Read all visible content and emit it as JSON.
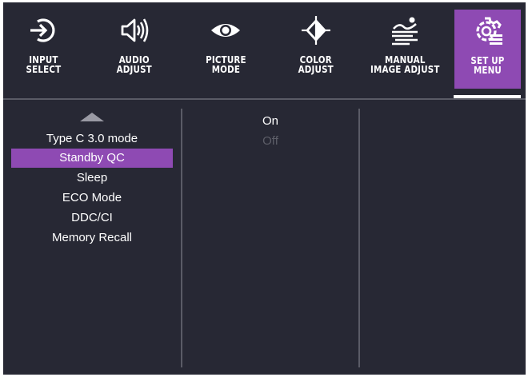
{
  "tabs": [
    {
      "label": "INPUT\nSELECT",
      "icon": "input-select-icon",
      "active": false
    },
    {
      "label": "AUDIO\nADJUST",
      "icon": "speaker-icon",
      "active": false
    },
    {
      "label": "PICTURE\nMODE",
      "icon": "eye-icon",
      "active": false
    },
    {
      "label": "COLOR\nADJUST",
      "icon": "color-adjust-icon",
      "active": false
    },
    {
      "label": "MANUAL\nIMAGE ADJUST",
      "icon": "image-adjust-icon",
      "active": false
    },
    {
      "label": "SET UP\nMENU",
      "icon": "setup-gear-icon",
      "active": true
    }
  ],
  "menu": {
    "items": [
      "Type C 3.0 mode",
      "Standby QC",
      "Sleep",
      "ECO Mode",
      "DDC/CI",
      "Memory Recall"
    ],
    "selected": "Standby QC"
  },
  "options": {
    "items": [
      "On",
      "Off"
    ],
    "disabled": [
      "Off"
    ]
  },
  "colors": {
    "background": "#272834",
    "accent": "#8e4ab3",
    "divider": "#5a5b66",
    "text": "#ffffff",
    "disabled_text": "#5d5e68"
  }
}
